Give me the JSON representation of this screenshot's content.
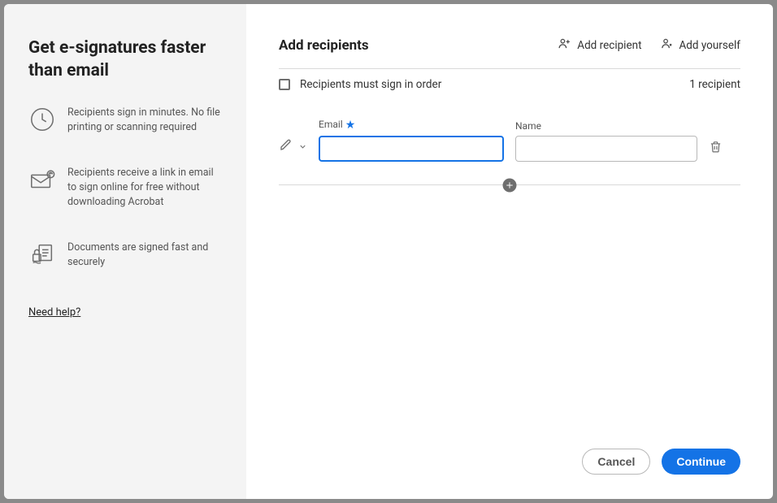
{
  "sidebar": {
    "title": "Get e-signatures faster than email",
    "benefits": [
      {
        "text": "Recipients sign in minutes. No file printing or scanning required"
      },
      {
        "text": "Recipients receive a link in email to sign online for free without downloading Acrobat"
      },
      {
        "text": "Documents are signed fast and securely"
      }
    ],
    "help_link": "Need help?"
  },
  "main": {
    "title": "Add recipients",
    "actions": {
      "add_recipient": "Add recipient",
      "add_yourself": "Add yourself"
    },
    "options": {
      "sign_in_order_label": "Recipients must sign in order",
      "recipient_count": "1 recipient"
    },
    "fields": {
      "email_label": "Email",
      "name_label": "Name"
    },
    "recipients": [
      {
        "email": "",
        "name": ""
      }
    ]
  },
  "footer": {
    "cancel": "Cancel",
    "continue": "Continue"
  }
}
